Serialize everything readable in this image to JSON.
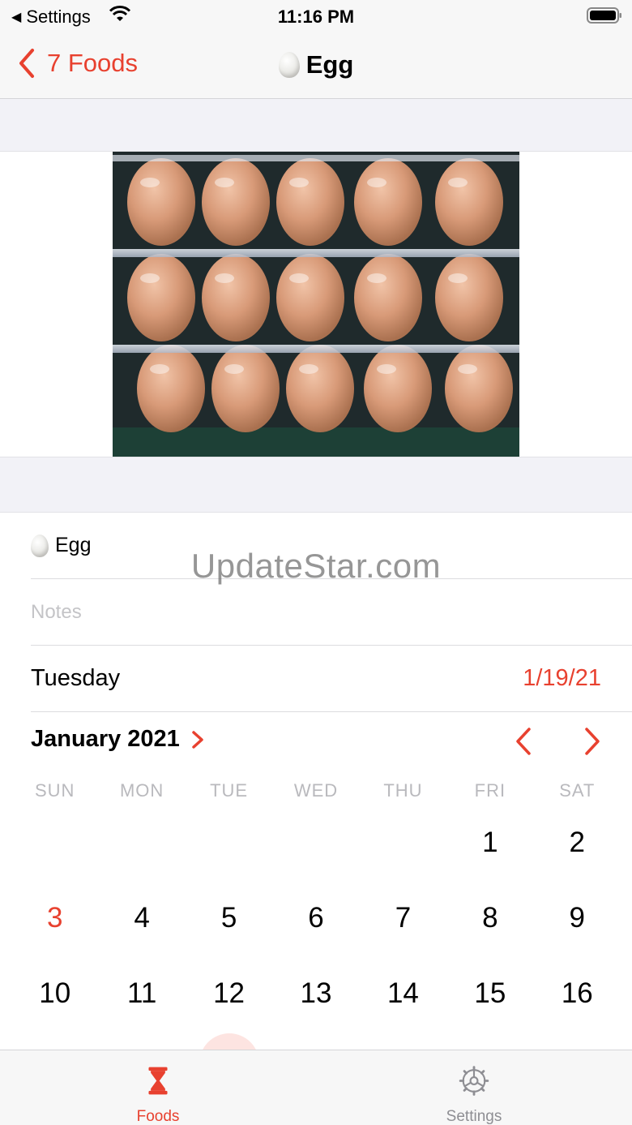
{
  "status_bar": {
    "back_app": "Settings",
    "time": "11:16 PM"
  },
  "nav": {
    "back_label": "7 Foods",
    "title": "Egg"
  },
  "food": {
    "name": "Egg",
    "notes_placeholder": "Notes",
    "weekday": "Tuesday",
    "date": "1/19/21"
  },
  "watermark": "UpdateStar.com",
  "calendar": {
    "month_label": "January 2021",
    "weekdays": [
      "SUN",
      "MON",
      "TUE",
      "WED",
      "THU",
      "FRI",
      "SAT"
    ],
    "days": [
      "",
      "",
      "",
      "",
      "",
      "1",
      "2",
      "3",
      "4",
      "5",
      "6",
      "7",
      "8",
      "9",
      "10",
      "11",
      "12",
      "13",
      "14",
      "15",
      "16"
    ],
    "today": "3"
  },
  "tabs": [
    {
      "label": "Foods",
      "icon": "hourglass-icon",
      "selected": true
    },
    {
      "label": "Settings",
      "icon": "gear-icon",
      "selected": false
    }
  ],
  "colors": {
    "accent": "#e8412f",
    "inactive": "#8e8e93",
    "grouped_background": "#f2f2f7"
  }
}
